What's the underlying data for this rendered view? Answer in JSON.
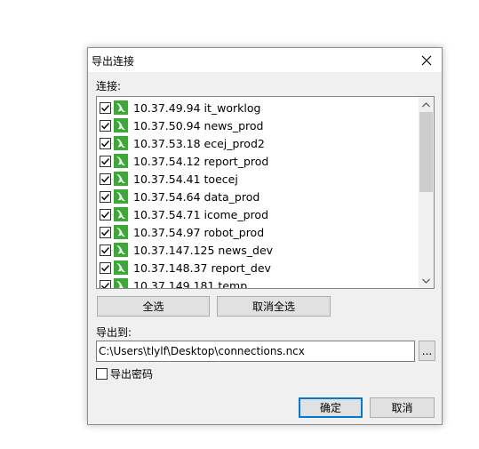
{
  "dialog": {
    "title": "导出连接",
    "connections_label": "连接:",
    "connections": [
      {
        "name": "10.37.49.94 it_worklog",
        "checked": true
      },
      {
        "name": "10.37.50.94 news_prod",
        "checked": true
      },
      {
        "name": "10.37.53.18 ecej_prod2",
        "checked": true
      },
      {
        "name": "10.37.54.12 report_prod",
        "checked": true
      },
      {
        "name": "10.37.54.41 toecej",
        "checked": true
      },
      {
        "name": "10.37.54.64 data_prod",
        "checked": true
      },
      {
        "name": "10.37.54.71 icome_prod",
        "checked": true
      },
      {
        "name": "10.37.54.97 robot_prod",
        "checked": true
      },
      {
        "name": "10.37.147.125 news_dev",
        "checked": true
      },
      {
        "name": "10.37.148.37 report_dev",
        "checked": true
      },
      {
        "name": "10.37.149.181 temp",
        "checked": true
      }
    ],
    "select_all_label": "全选",
    "deselect_all_label": "取消全选",
    "export_to_label": "导出到:",
    "export_path": "C:\\Users\\tlylf\\Desktop\\connections.ncx",
    "browse_label": "...",
    "export_password_label": "导出密码",
    "export_password_checked": false,
    "ok_label": "确定",
    "cancel_label": "取消"
  },
  "colors": {
    "connection_icon": "#3aaa35",
    "default_button_border": "#0078d7"
  },
  "icons": {
    "close": "close-icon",
    "connection": "mysql-connection-icon",
    "check": "checkmark-icon",
    "scroll_up": "chevron-up-icon",
    "scroll_down": "chevron-down-icon"
  }
}
